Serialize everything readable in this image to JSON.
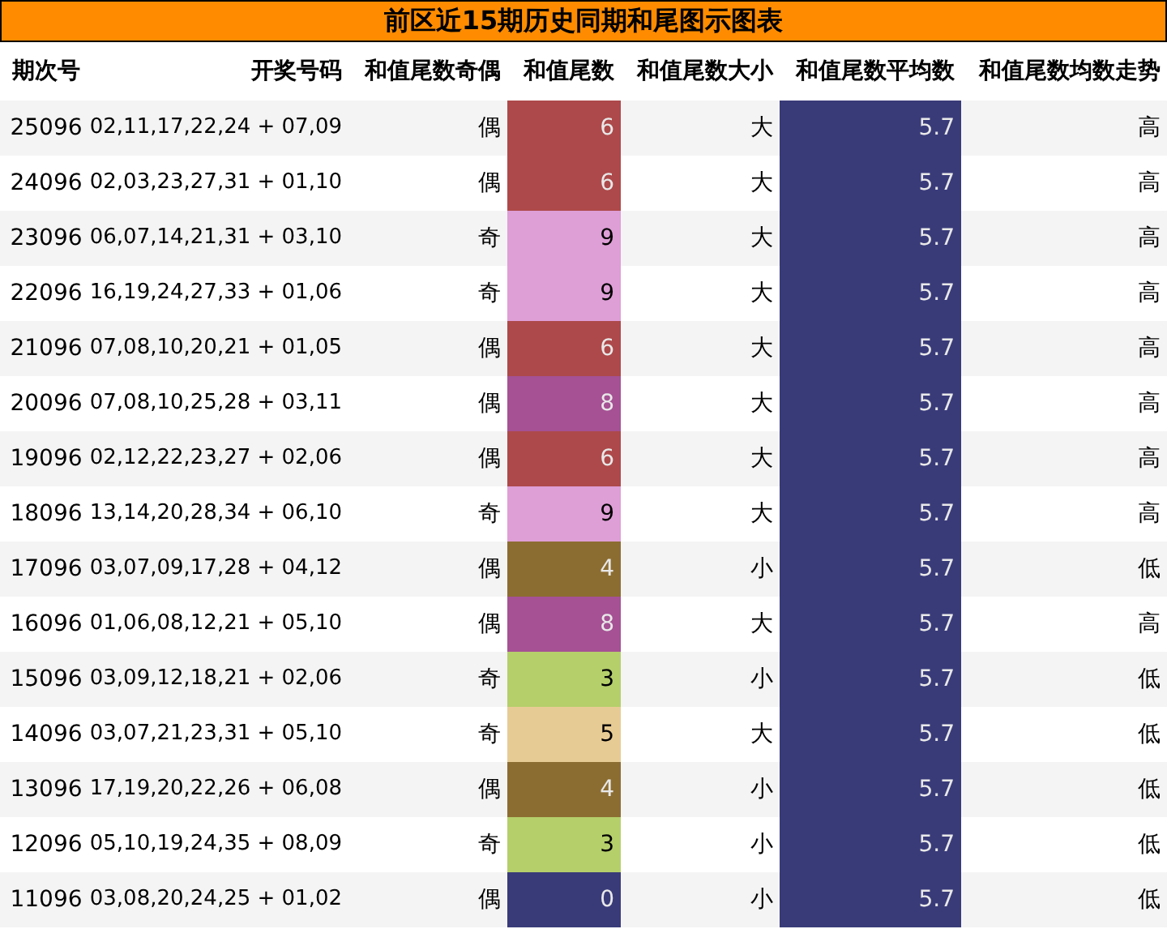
{
  "title": "前区近15期历史同期和尾图示图表",
  "columns": [
    "期次号",
    "开奖号码",
    "和值尾数奇偶",
    "和值尾数",
    "和值尾数大小",
    "和值尾数平均数",
    "和值尾数均数走势"
  ],
  "rows": [
    {
      "issue": "25096",
      "numbers": "02,11,17,22,24 + 07,09",
      "parity": "偶",
      "tail": "6",
      "color": "#ad494a",
      "size": "大",
      "avg": "5.7",
      "trend": "高"
    },
    {
      "issue": "24096",
      "numbers": "02,03,23,27,31 + 01,10",
      "parity": "偶",
      "tail": "6",
      "color": "#ad494a",
      "size": "大",
      "avg": "5.7",
      "trend": "高"
    },
    {
      "issue": "23096",
      "numbers": "06,07,14,21,31 + 03,10",
      "parity": "奇",
      "tail": "9",
      "color": "#de9ed6",
      "size": "大",
      "avg": "5.7",
      "trend": "高"
    },
    {
      "issue": "22096",
      "numbers": "16,19,24,27,33 + 01,06",
      "parity": "奇",
      "tail": "9",
      "color": "#de9ed6",
      "size": "大",
      "avg": "5.7",
      "trend": "高"
    },
    {
      "issue": "21096",
      "numbers": "07,08,10,20,21 + 01,05",
      "parity": "偶",
      "tail": "6",
      "color": "#ad494a",
      "size": "大",
      "avg": "5.7",
      "trend": "高"
    },
    {
      "issue": "20096",
      "numbers": "07,08,10,25,28 + 03,11",
      "parity": "偶",
      "tail": "8",
      "color": "#a55194",
      "size": "大",
      "avg": "5.7",
      "trend": "高"
    },
    {
      "issue": "19096",
      "numbers": "02,12,22,23,27 + 02,06",
      "parity": "偶",
      "tail": "6",
      "color": "#ad494a",
      "size": "大",
      "avg": "5.7",
      "trend": "高"
    },
    {
      "issue": "18096",
      "numbers": "13,14,20,28,34 + 06,10",
      "parity": "奇",
      "tail": "9",
      "color": "#de9ed6",
      "size": "大",
      "avg": "5.7",
      "trend": "高"
    },
    {
      "issue": "17096",
      "numbers": "03,07,09,17,28 + 04,12",
      "parity": "偶",
      "tail": "4",
      "color": "#8c6d31",
      "size": "小",
      "avg": "5.7",
      "trend": "低"
    },
    {
      "issue": "16096",
      "numbers": "01,06,08,12,21 + 05,10",
      "parity": "偶",
      "tail": "8",
      "color": "#a55194",
      "size": "大",
      "avg": "5.7",
      "trend": "高"
    },
    {
      "issue": "15096",
      "numbers": "03,09,12,18,21 + 02,06",
      "parity": "奇",
      "tail": "3",
      "color": "#b5cf6b",
      "size": "小",
      "avg": "5.7",
      "trend": "低"
    },
    {
      "issue": "14096",
      "numbers": "03,07,21,23,31 + 05,10",
      "parity": "奇",
      "tail": "5",
      "color": "#e7cb94",
      "size": "大",
      "avg": "5.7",
      "trend": "低"
    },
    {
      "issue": "13096",
      "numbers": "17,19,20,22,26 + 06,08",
      "parity": "偶",
      "tail": "4",
      "color": "#8c6d31",
      "size": "小",
      "avg": "5.7",
      "trend": "低"
    },
    {
      "issue": "12096",
      "numbers": "05,10,19,24,35 + 08,09",
      "parity": "奇",
      "tail": "3",
      "color": "#b5cf6b",
      "size": "小",
      "avg": "5.7",
      "trend": "低"
    },
    {
      "issue": "11096",
      "numbers": "03,08,20,24,25 + 01,02",
      "parity": "偶",
      "tail": "0",
      "color": "#393b79",
      "size": "小",
      "avg": "5.7",
      "trend": "低"
    }
  ]
}
